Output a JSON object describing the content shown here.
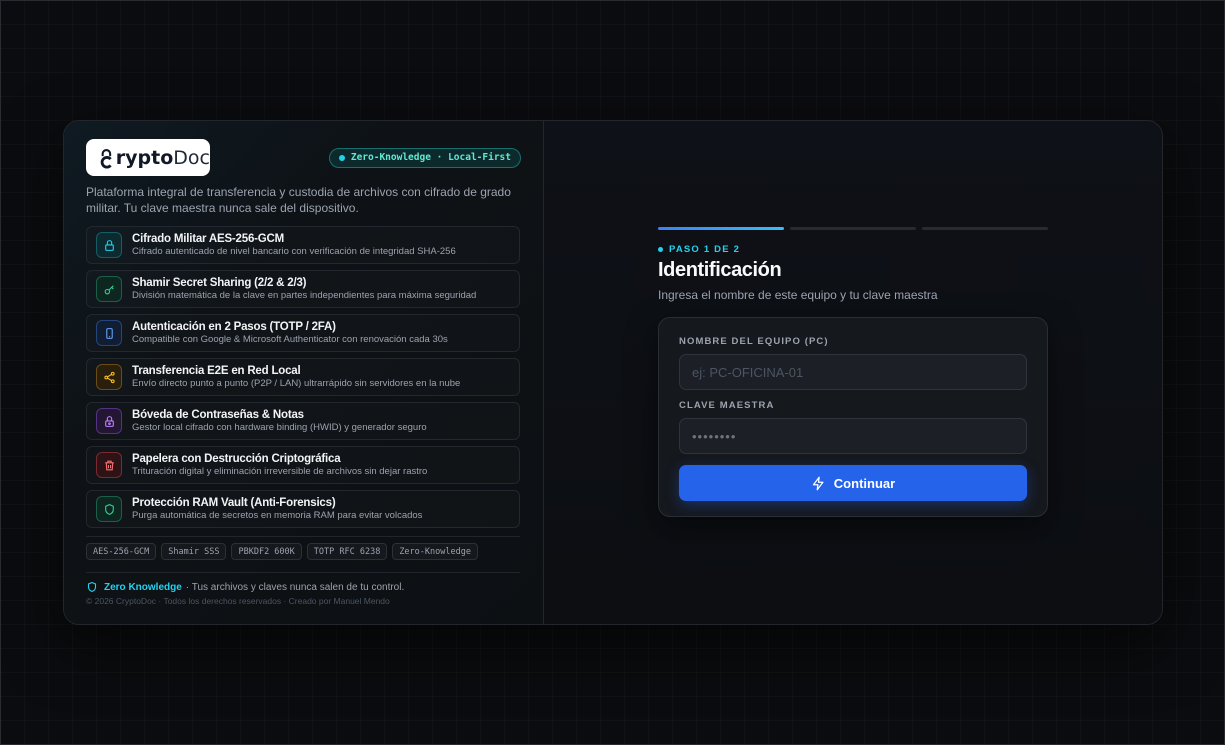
{
  "brand": {
    "name_bold": "rypto",
    "name_light": "Doc",
    "badge": "Zero-Knowledge · Local-First"
  },
  "description": "Plataforma integral de transferencia y custodia de archivos con cifrado de grado militar. Tu clave maestra nunca sale del dispositivo.",
  "features": [
    {
      "title": "Cifrado Militar AES-256-GCM",
      "subtitle": "Cifrado autenticado de nivel bancario con verificación de integridad SHA-256",
      "icon": "lock-icon",
      "color": "#22d3ee"
    },
    {
      "title": "Shamir Secret Sharing (2/2 & 2/3)",
      "subtitle": "División matemática de la clave en partes independientes para máxima seguridad",
      "icon": "key-icon",
      "color": "#34d399"
    },
    {
      "title": "Autenticación en 2 Pasos (TOTP / 2FA)",
      "subtitle": "Compatible con Google & Microsoft Authenticator con renovación cada 30s",
      "icon": "smartphone-icon",
      "color": "#60a5fa"
    },
    {
      "title": "Transferencia E2E en Red Local",
      "subtitle": "Envío directo punto a punto (P2P / LAN) ultrarrápido sin servidores en la nube",
      "icon": "share-icon",
      "color": "#fbbf24"
    },
    {
      "title": "Bóveda de Contraseñas & Notas",
      "subtitle": "Gestor local cifrado con hardware binding (HWID) y generador seguro",
      "icon": "vault-icon",
      "color": "#c084fc"
    },
    {
      "title": "Papelera con Destrucción Criptográfica",
      "subtitle": "Trituración digital y eliminación irreversible de archivos sin dejar rastro",
      "icon": "trash-icon",
      "color": "#f87171"
    },
    {
      "title": "Protección RAM Vault (Anti-Forensics)",
      "subtitle": "Purga automática de secretos en memoria RAM para evitar volcados",
      "icon": "shield-icon",
      "color": "#34d399"
    }
  ],
  "tags": [
    "AES-256-GCM",
    "Shamir SSS",
    "PBKDF2 600K",
    "TOTP RFC 6238",
    "Zero-Knowledge"
  ],
  "footer": {
    "zk_label": "Zero Knowledge",
    "zk_text": "· Tus archivos y claves nunca salen de tu control.",
    "copyright": "© 2026 CryptoDoc · Todos los derechos reservados · Creado por Manuel Mendo"
  },
  "form": {
    "step_label": "PASO 1 DE 2",
    "step_current": 1,
    "step_total": 3,
    "title": "Identificación",
    "subtitle": "Ingresa el nombre de este equipo y tu clave maestra",
    "pc_label": "NOMBRE DEL EQUIPO (PC)",
    "pc_placeholder": "ej: PC-OFICINA-01",
    "key_label": "CLAVE MAESTRA",
    "key_placeholder": "••••••••",
    "button_label": "Continuar"
  },
  "colors": {
    "accent": "#22d3ee",
    "primary_button": "#2563eb"
  }
}
